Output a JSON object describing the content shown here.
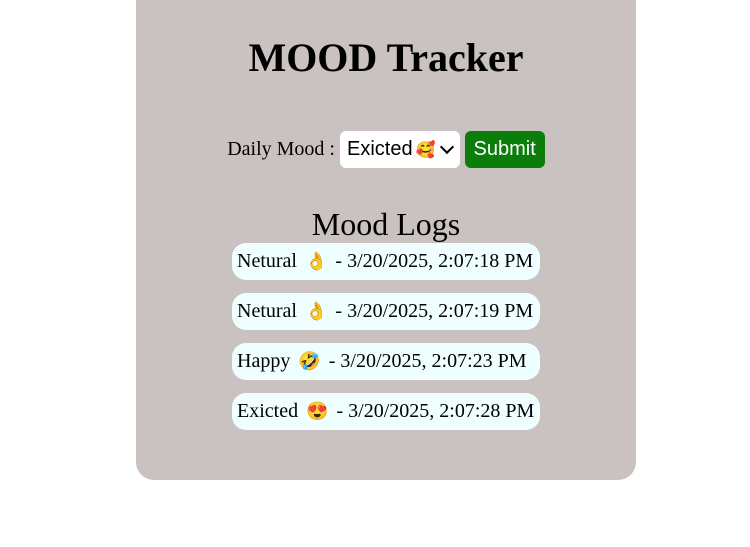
{
  "header": {
    "title": "MOOD Tracker"
  },
  "form": {
    "label": "Daily Mood :",
    "selected_value": "Exicted",
    "selected_emoji": "🥰",
    "submit_label": "Submit"
  },
  "logs": {
    "heading": "Mood Logs",
    "items": [
      {
        "mood": "Netural",
        "emoji": "👌",
        "timestamp": "- 3/20/2025, 2:07:18 PM"
      },
      {
        "mood": "Netural",
        "emoji": "👌",
        "timestamp": "- 3/20/2025, 2:07:19 PM"
      },
      {
        "mood": "Happy",
        "emoji": "🤣",
        "timestamp": "- 3/20/2025, 2:07:23 PM"
      },
      {
        "mood": "Exicted",
        "emoji": "😍",
        "timestamp": "- 3/20/2025, 2:07:28 PM"
      }
    ]
  },
  "colors": {
    "card_background": "#cac1c1",
    "submit_background": "#0a7d0a",
    "log_background": "#efffff"
  }
}
